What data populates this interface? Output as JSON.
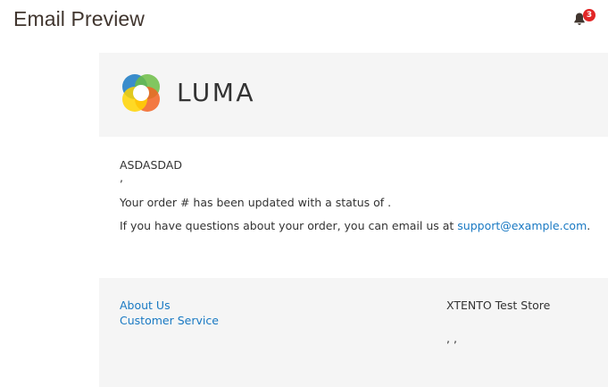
{
  "header": {
    "title": "Email Preview",
    "notifications_count": "3"
  },
  "email": {
    "logo_text": "LUMA",
    "greeting": "ASDASDAD",
    "comma_line": ",",
    "status_text": "Your order # has been updated with a status of .",
    "questions_text": "If you have questions about your order, you can email us at ",
    "support_email": "support@example.com",
    "questions_end": ".",
    "footer": {
      "links": [
        "About Us",
        "Customer Service"
      ],
      "store_name": "XTENTO Test Store",
      "address": ", ,"
    }
  },
  "colors": {
    "link": "#1979c3",
    "badge": "#e22626",
    "panel": "#f5f5f5",
    "logo_blue": "#1979c3",
    "logo_green": "#6cbd45",
    "logo_orange": "#f26322",
    "logo_yellow": "#ffd400"
  },
  "icons": [
    "bell-icon",
    "luma-logo-icon"
  ]
}
